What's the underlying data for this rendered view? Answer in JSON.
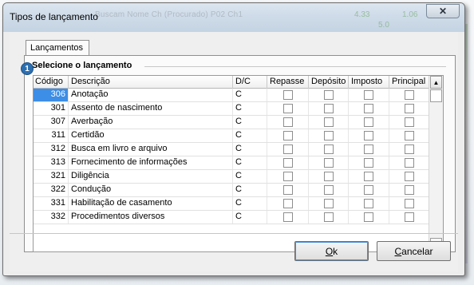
{
  "window": {
    "title": "Tipos de lançamento",
    "close_glyph": "✕",
    "background_text": "Buscam Nome Ch (Procurado) P02 Ch1",
    "background_numbers": [
      "4.33",
      "1.06",
      "5.0"
    ]
  },
  "tab": {
    "label": "Lançamentos"
  },
  "section": {
    "title": "Selecione o lançamento"
  },
  "badge": {
    "number": "1"
  },
  "grid": {
    "columns": [
      "Código",
      "Descrição",
      "D/C",
      "Repasse",
      "Depósito",
      "Imposto",
      "Principal"
    ],
    "rows": [
      {
        "code": "306",
        "desc": "Anotação",
        "dc": "C",
        "selected": true
      },
      {
        "code": "301",
        "desc": "Assento de nascimento",
        "dc": "C"
      },
      {
        "code": "307",
        "desc": "Averbação",
        "dc": "C"
      },
      {
        "code": "311",
        "desc": "Certidão",
        "dc": "C"
      },
      {
        "code": "312",
        "desc": "Busca em livro e arquivo",
        "dc": "C"
      },
      {
        "code": "313",
        "desc": "Fornecimento de informações",
        "dc": "C"
      },
      {
        "code": "321",
        "desc": "Diligência",
        "dc": "C"
      },
      {
        "code": "322",
        "desc": "Condução",
        "dc": "C"
      },
      {
        "code": "331",
        "desc": "Habilitação de casamento",
        "dc": "C"
      },
      {
        "code": "332",
        "desc": "Procedimentos diversos",
        "dc": "C"
      }
    ],
    "scroll_up_icon": "▲",
    "scroll_down_icon": "▼"
  },
  "buttons": {
    "ok_mnemonic": "O",
    "ok_rest": "k",
    "cancel_mnemonic": "C",
    "cancel_rest": "ancelar"
  },
  "colors": {
    "selection": "#3d8ee6",
    "badge": "#2c6fb1"
  }
}
